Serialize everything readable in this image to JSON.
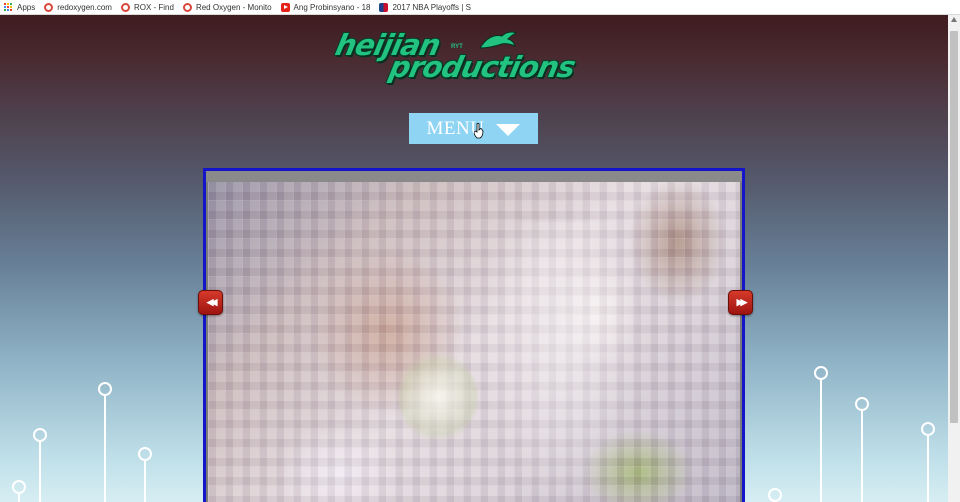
{
  "bookmarks": [
    {
      "label": "Apps",
      "icon": "apps-grid-icon"
    },
    {
      "label": "redoxygen.com",
      "icon": "red-oxygen-icon"
    },
    {
      "label": "ROX - Find",
      "icon": "red-oxygen-icon"
    },
    {
      "label": "Red Oxygen - Monito",
      "icon": "red-oxygen-icon"
    },
    {
      "label": "Ang Probinsyano - 18",
      "icon": "youtube-icon"
    },
    {
      "label": "2017 NBA Playoffs | S",
      "icon": "nba-icon"
    }
  ],
  "logo": {
    "line1": "heijian",
    "line2": "productions",
    "tag": "RYT",
    "color": "#22c281"
  },
  "menu": {
    "label": "MENU",
    "color": "#8fd4f3"
  },
  "slideshow": {
    "border_color": "#1414c8",
    "prev_label": "◀◀",
    "next_label": "▶▶"
  }
}
